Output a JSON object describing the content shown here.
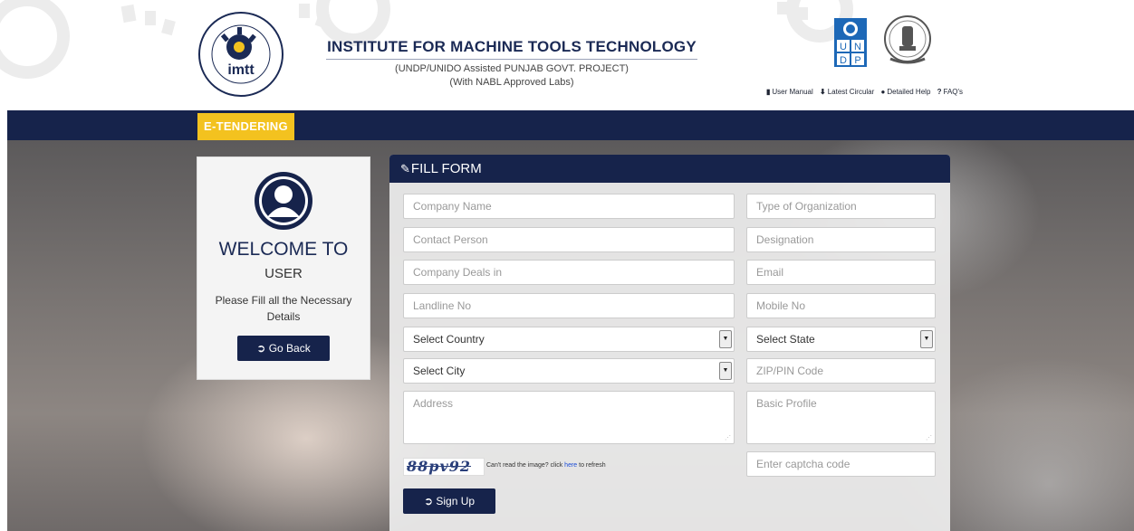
{
  "header": {
    "title": "INSTITUTE FOR MACHINE TOOLS TECHNOLOGY",
    "subtitle1": "(UNDP/UNIDO Assisted PUNJAB GOVT. PROJECT)",
    "subtitle2": "(With NABL Approved Labs)",
    "logo_text": "imtt",
    "undp_letters": [
      "U",
      "N",
      "D",
      "P"
    ],
    "links": [
      {
        "icon": "document-icon",
        "glyph": "▮",
        "label": "User Manual"
      },
      {
        "icon": "download-icon",
        "glyph": "⬇",
        "label": "Latest Circular"
      },
      {
        "icon": "info-icon",
        "glyph": "●",
        "label": "Detailed Help"
      },
      {
        "icon": "question-icon",
        "glyph": "?",
        "label": "FAQ's"
      }
    ]
  },
  "nav": {
    "badge": "E-TENDERING"
  },
  "welcome": {
    "title": "WELCOME TO",
    "subtitle": "USER",
    "text": "Please Fill all the Necessary Details",
    "button": "Go Back"
  },
  "form": {
    "heading": "FILL FORM",
    "fields": {
      "company_name": "Company Name",
      "org_type": "Type of Organization",
      "contact_person": "Contact Person",
      "designation": "Designation",
      "deals_in": "Company Deals in",
      "email": "Email",
      "landline": "Landline No",
      "mobile": "Mobile No",
      "country": "Select Country",
      "state": "Select State",
      "city": "Select City",
      "zip": "ZIP/PIN Code",
      "address": "Address",
      "profile": "Basic Profile",
      "captcha_input": "Enter captcha code"
    },
    "captcha": {
      "code": "88pv92",
      "hint_before": "Can't read the image? click ",
      "hint_link": "here",
      "hint_after": " to refresh"
    },
    "submit": "Sign Up"
  },
  "colors": {
    "navy": "#16234b",
    "gold": "#f3c21f",
    "undp_blue": "#1d68b7"
  }
}
